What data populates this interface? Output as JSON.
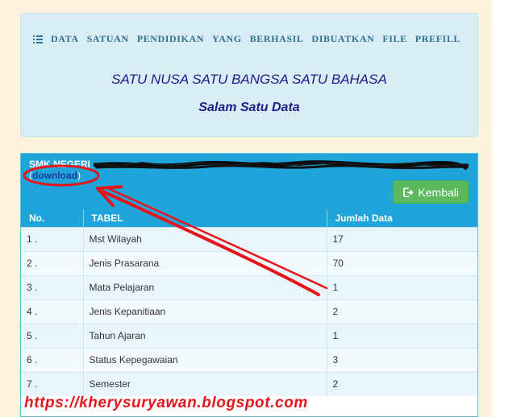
{
  "info": {
    "heading_words": [
      "DATA",
      "SATUAN",
      "PENDIDIKAN",
      "YANG",
      "BERHASIL",
      "DIBUATKAN",
      "FILE",
      "PREFILL"
    ],
    "motto": "SATU NUSA SATU BANGSA SATU BAHASA",
    "greeting": "Salam Satu Data"
  },
  "panel": {
    "school_name": "SMK NEGERI",
    "download_open": "(",
    "download_label": "download",
    "download_close": ")",
    "back_label": "Kembali"
  },
  "table": {
    "headers": [
      "No.",
      "TABEL",
      "Jumlah Data"
    ],
    "rows": [
      {
        "no": "1 .",
        "tabel": "Mst Wilayah",
        "jumlah": "17"
      },
      {
        "no": "2 .",
        "tabel": "Jenis Prasarana",
        "jumlah": "70"
      },
      {
        "no": "3 .",
        "tabel": "Mata Pelajaran",
        "jumlah": "1"
      },
      {
        "no": "4 .",
        "tabel": "Jenis Kepanitiaan",
        "jumlah": "2"
      },
      {
        "no": "5 .",
        "tabel": "Tahun Ajaran",
        "jumlah": "1"
      },
      {
        "no": "6 .",
        "tabel": "Status Kepegawaian",
        "jumlah": "3"
      },
      {
        "no": "7 .",
        "tabel": "Semester",
        "jumlah": "2"
      }
    ]
  },
  "watermark": "https://kherysuryawan.blogspot.com",
  "colors": {
    "panel_blue": "#1fa5d9",
    "info_bg": "#d9edf7",
    "success_green": "#5cb85c",
    "annotation_red": "#e8141c",
    "motto_navy": "#1d1d88"
  }
}
